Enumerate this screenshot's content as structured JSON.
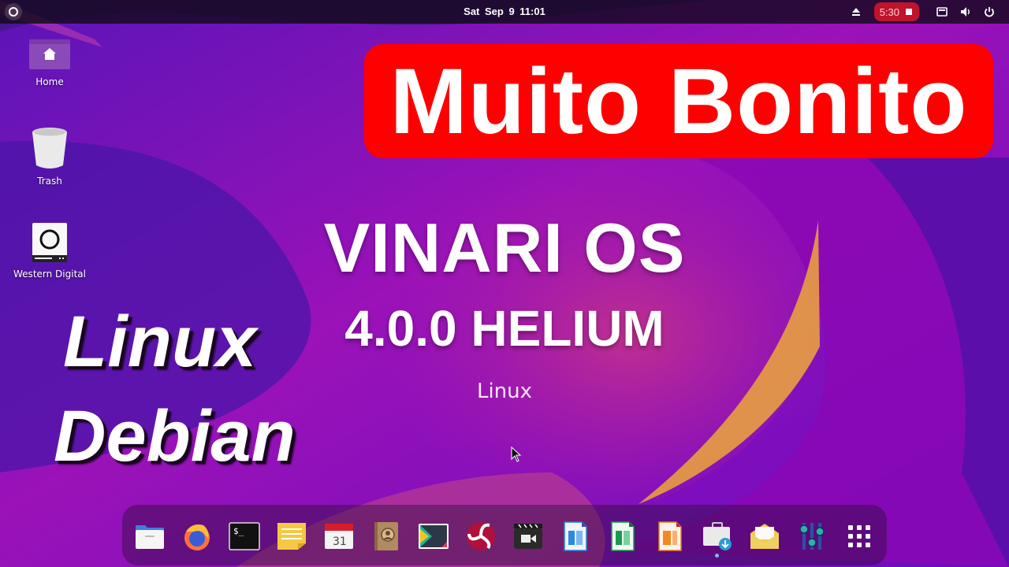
{
  "topbar": {
    "activities_icon": "activities-icon",
    "clock": "Sat Sep 9  11:01",
    "tray": {
      "eject_icon": "eject-icon",
      "recording_time": "5:30",
      "stop_icon": "stop-icon",
      "screen_icon": "display-icon",
      "volume_icon": "volume-icon",
      "power_icon": "power-icon"
    },
    "recording_color": "#c0132c"
  },
  "desktop": {
    "icons": [
      {
        "label": "Home",
        "icon": "home-folder-icon"
      },
      {
        "label": "Trash",
        "icon": "trash-icon"
      },
      {
        "label": "Western Digital",
        "icon": "drive-icon"
      }
    ]
  },
  "overlay": {
    "banner_text": "Muito Bonito",
    "banner_color": "#fe0000",
    "title": "VINARI OS",
    "version": "4.0.0 HELIUM",
    "tagline": "Linux",
    "side_line1": "Linux",
    "side_line2": "Debian"
  },
  "dock": {
    "items": [
      {
        "name": "Files",
        "icon": "files-icon"
      },
      {
        "name": "Firefox",
        "icon": "firefox-icon"
      },
      {
        "name": "Terminal",
        "icon": "terminal-icon",
        "glyph": "$_"
      },
      {
        "name": "Notes",
        "icon": "notes-icon"
      },
      {
        "name": "Calendar",
        "icon": "calendar-icon",
        "glyph": "31"
      },
      {
        "name": "Contacts",
        "icon": "contacts-icon"
      },
      {
        "name": "Software Store",
        "icon": "store-icon"
      },
      {
        "name": "Debian App",
        "icon": "swirl-icon"
      },
      {
        "name": "Video Editor",
        "icon": "video-icon"
      },
      {
        "name": "LibreOffice Writer",
        "icon": "writer-icon"
      },
      {
        "name": "LibreOffice Calc",
        "icon": "calc-icon"
      },
      {
        "name": "LibreOffice Impress",
        "icon": "impress-icon"
      },
      {
        "name": "Software Installer",
        "icon": "installer-icon",
        "running": true
      },
      {
        "name": "Mail",
        "icon": "mail-icon"
      },
      {
        "name": "Settings Tweaks",
        "icon": "equalizer-icon"
      },
      {
        "name": "Show Applications",
        "icon": "app-grid-icon"
      }
    ]
  }
}
